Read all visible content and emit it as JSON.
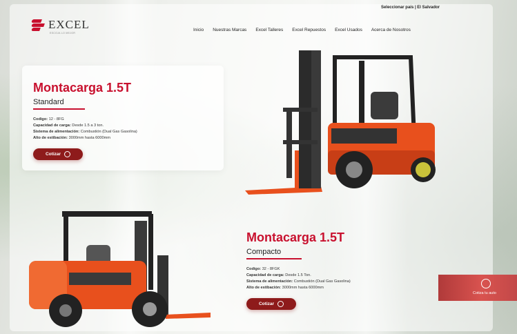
{
  "topbar": {
    "country_selector": "Seleccionar país | El Salvador"
  },
  "brand": {
    "name": "EXCEL",
    "tagline": "ESCOJA LO MEJOR"
  },
  "nav": [
    {
      "label": "Inicio"
    },
    {
      "label": "Nuestras Marcas"
    },
    {
      "label": "Excel Talleres"
    },
    {
      "label": "Excel Repuestos"
    },
    {
      "label": "Excel Usados"
    },
    {
      "label": "Acerca de Nosotros"
    }
  ],
  "products": [
    {
      "title": "Montacarga 1.5T",
      "subtitle": "Standard",
      "code_label": "Codigo:",
      "code_value": "12 - 8FG",
      "capacity_label": "Capacidad de carga:",
      "capacity_value": "Desde 1.5 a 3 ton.",
      "system_label": "Sistema de alimentación:",
      "system_value": "Combustión (Dual Gas Gasolina)",
      "height_label": "Alto de estibación:",
      "height_value": "3000mm hasta 6000mm",
      "cta": "Cotizar"
    },
    {
      "title": "Montacarga 1.5T",
      "subtitle": "Compacto",
      "code_label": "Codigo:",
      "code_value": "32 - 8FGK",
      "capacity_label": "Capacidad de carga:",
      "capacity_value": "Desde 1.5 Ton.",
      "system_label": "Sistema de alimentación:",
      "system_value": "Combustión (Dual Gas Gasolina)",
      "height_label": "Alto de estibación:",
      "height_value": "3000mm hasta 6000mm",
      "cta": "Cotizar"
    }
  ],
  "floating_badge": {
    "label": "Cotiza tu auto"
  },
  "colors": {
    "brand_red": "#c8102e",
    "cta_dark_red": "#8e1b1b",
    "forklift_orange": "#e8501d"
  }
}
